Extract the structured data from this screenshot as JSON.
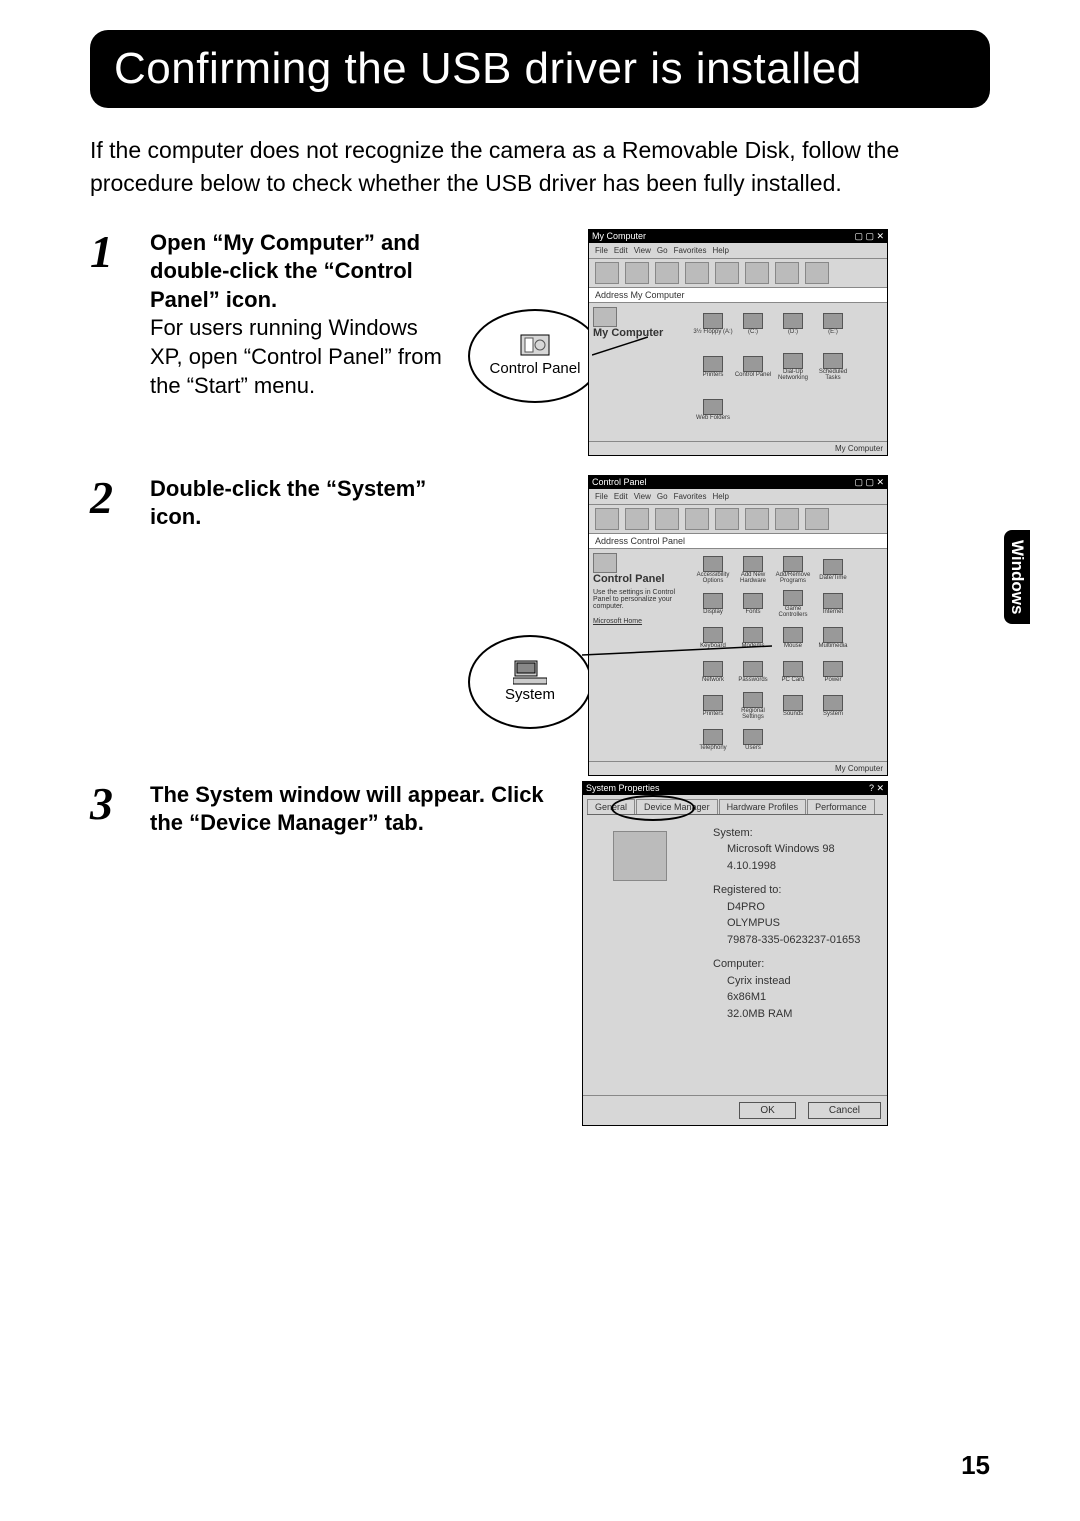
{
  "title": "Confirming the USB driver is installed",
  "intro": "If the computer does not recognize the camera as a Removable Disk, follow the procedure below to check whether the USB driver has been fully installed.",
  "side_tab": "Windows",
  "page_number": "15",
  "steps": [
    {
      "num": "1",
      "bold": "Open “My Computer” and double-click the “Control Panel” icon.",
      "rest": "For users running Windows XP, open “Control Panel” from the “Start” menu.",
      "callout": "Control Panel"
    },
    {
      "num": "2",
      "bold": "Double-click the “System” icon.",
      "rest": "",
      "callout": "System"
    },
    {
      "num": "3",
      "bold": "The System window will appear. Click the “Device Manager” tab.",
      "rest": "",
      "callout": ""
    }
  ],
  "win1": {
    "title": "My Computer",
    "menu": [
      "File",
      "Edit",
      "View",
      "Go",
      "Favorites",
      "Help"
    ],
    "addr": "Address   My Computer",
    "left_header": "My Computer",
    "icons": [
      "3½ Floppy (A:)",
      "(C:)",
      "(D:)",
      "(E:)",
      "Printers",
      "Control Panel",
      "Dial-Up Networking",
      "Scheduled Tasks",
      "Web Folders"
    ],
    "status": "My Computer"
  },
  "win2": {
    "title": "Control Panel",
    "menu": [
      "File",
      "Edit",
      "View",
      "Go",
      "Favorites",
      "Help"
    ],
    "addr": "Address   Control Panel",
    "left_header": "Control Panel",
    "left_text": "Use the settings in Control Panel to personalize your computer.",
    "left_link": "Microsoft Home",
    "icons": [
      "Accessibility Options",
      "Add New Hardware",
      "Add/Remove Programs",
      "Date/Time",
      "Display",
      "Fonts",
      "Game Controllers",
      "Internet",
      "Keyboard",
      "Modems",
      "Mouse",
      "Multimedia",
      "Network",
      "Passwords",
      "PC Card",
      "Power",
      "Printers",
      "Regional Settings",
      "Sounds",
      "System",
      "Telephony",
      "Users"
    ],
    "status": "My Computer"
  },
  "win3": {
    "title": "System Properties",
    "tabs": [
      "General",
      "Device Manager",
      "Hardware Profiles",
      "Performance"
    ],
    "highlight_tab": "Device Manager",
    "body": {
      "h1": "System:",
      "l1": "Microsoft Windows 98",
      "l2": "4.10.1998",
      "h2": "Registered to:",
      "l3": "D4PRO",
      "l4": "OLYMPUS",
      "l5": "79878-335-0623237-01653",
      "h3": "Computer:",
      "l6": "Cyrix instead",
      "l7": "6x86M1",
      "l8": "32.0MB RAM"
    },
    "buttons": [
      "OK",
      "Cancel"
    ]
  }
}
